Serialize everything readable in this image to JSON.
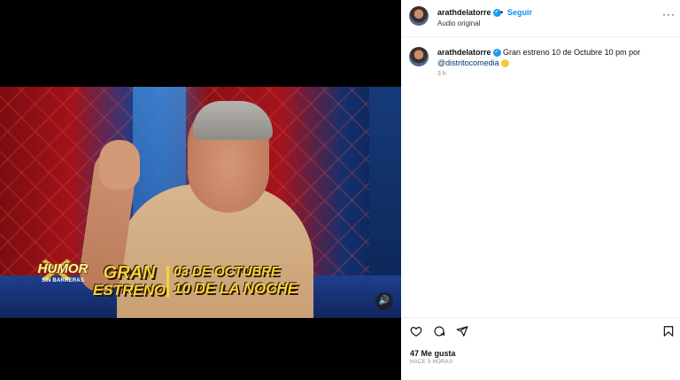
{
  "video": {
    "logo_word": "HUMOR",
    "logo_sub": "SIN BARRERAS",
    "promo_line1": "GRAN",
    "promo_line2": "ESTRENO",
    "promo_date": "03 DE OCTUBRE",
    "promo_time": "10 DE LA NOCHE",
    "audio_icon": "speaker-icon"
  },
  "header": {
    "username": "arathdelatorre",
    "separator": "•",
    "follow_label": "Seguir",
    "audio_label": "Audio original",
    "more_label": "···"
  },
  "comment": {
    "username": "arathdelatorre",
    "text": "Gran estreno 10 de Octubre 10 pm por",
    "mention": "@distritocomedia",
    "time": "3 h"
  },
  "actions": {
    "likes": "47 Me gusta",
    "posted": "HACE 3 HORAS"
  },
  "colors": {
    "accent": "#0095f6",
    "verified": "#1d9bf0",
    "promo_text": "#f5d23a"
  }
}
